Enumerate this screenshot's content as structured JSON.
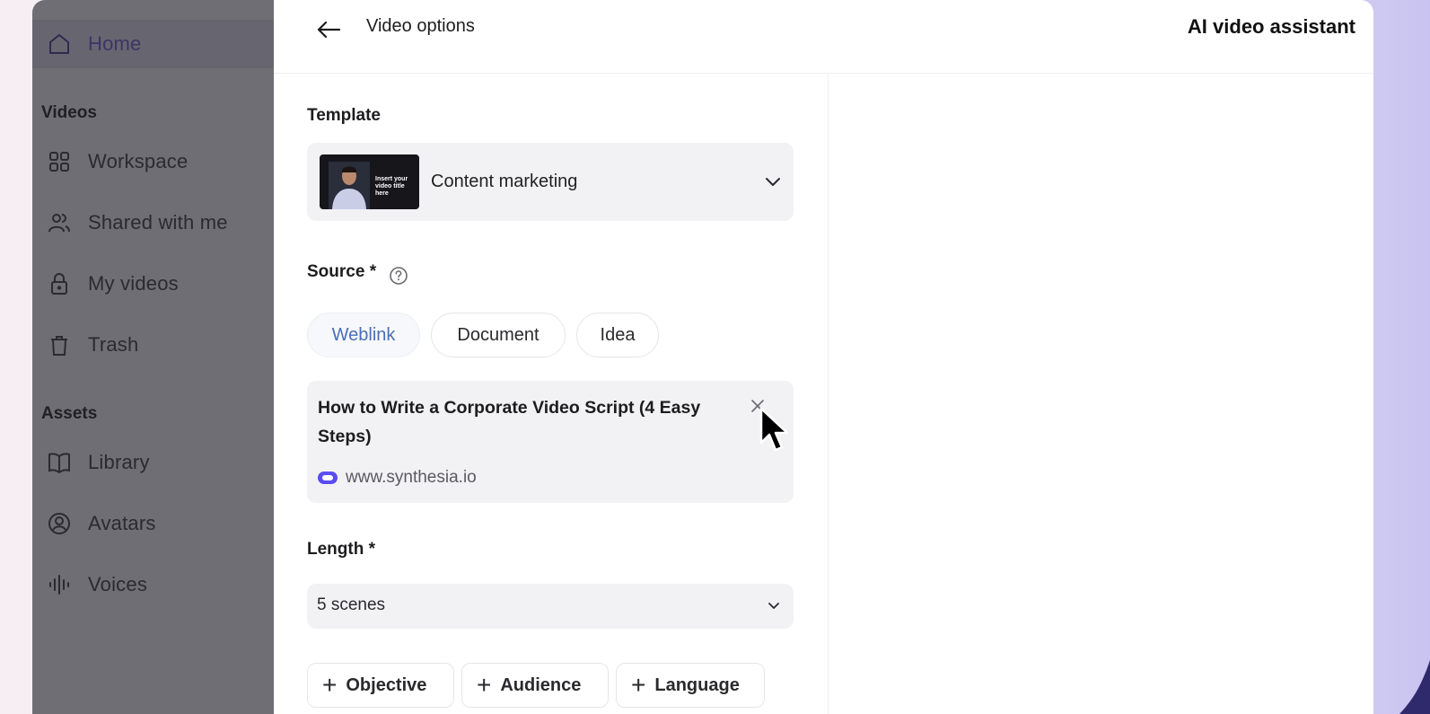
{
  "sidebar": {
    "home_label": "Home",
    "videos_section": "Videos",
    "workspace_label": "Workspace",
    "shared_label": "Shared with me",
    "myvideos_label": "My videos",
    "trash_label": "Trash",
    "assets_section": "Assets",
    "library_label": "Library",
    "avatars_label": "Avatars",
    "voices_label": "Voices"
  },
  "header": {
    "title": "Video options",
    "assistant_title": "AI video assistant"
  },
  "template": {
    "label": "Template",
    "selected": "Content marketing",
    "thumbnail_text": "Insert your video title here"
  },
  "source": {
    "label": "Source *",
    "chips": [
      "Weblink",
      "Document",
      "Idea"
    ],
    "selected_chip": "Weblink",
    "card_title": "How to Write a Corporate Video Script (4 Easy Steps)",
    "card_url": "www.synthesia.io"
  },
  "length": {
    "label": "Length *",
    "selected": "5 scenes"
  },
  "add_options": {
    "objective": "Objective",
    "audience": "Audience",
    "language": "Language"
  },
  "colors": {
    "accent": "#4a6fb5",
    "sidebar_dim": "#6f6e74",
    "brand_icon": "#5b4cf0"
  }
}
